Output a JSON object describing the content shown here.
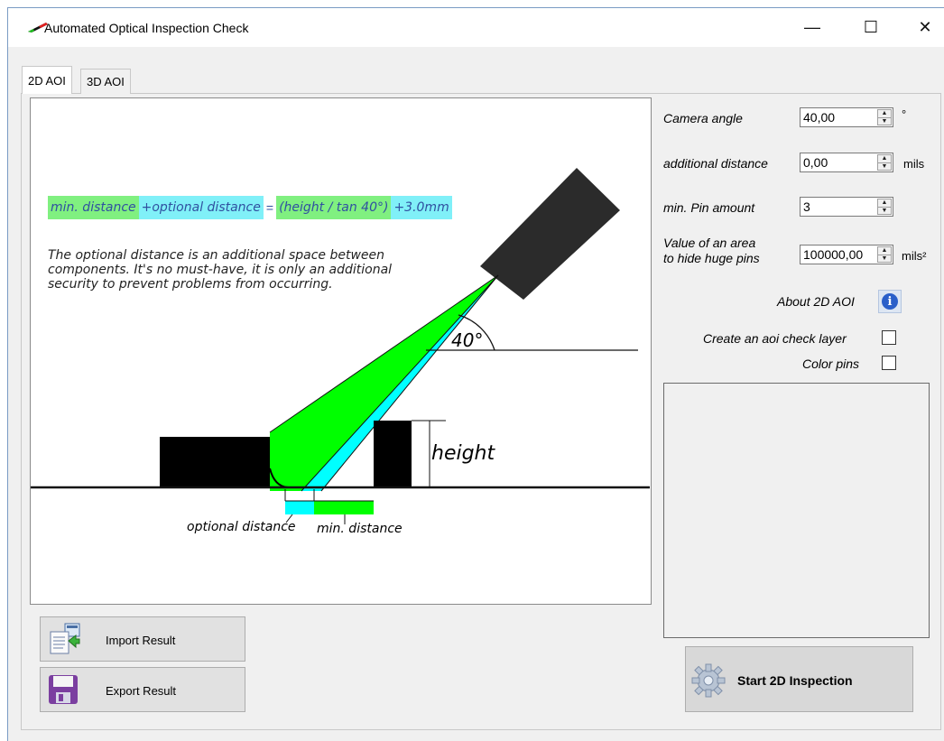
{
  "window": {
    "title": "Automated Optical Inspection Check",
    "controls": {
      "minimize": "—",
      "maximize": "☐",
      "close": "✕"
    }
  },
  "tabs": [
    {
      "label": "2D AOI",
      "active": true
    },
    {
      "label": "3D AOI",
      "active": false
    }
  ],
  "diagram": {
    "formula": {
      "min_distance": "min. distance",
      "optional_distance": "+optional distance",
      "equals": "=",
      "height_tan": "(height / tan 40°)",
      "offset": "+3.0mm"
    },
    "description": "The optional distance is an additional space between components. It's no must-have, it is only an additional security to prevent problems from occurring.",
    "angle_label": "40°",
    "height_label": "height",
    "optional_distance_label": "optional distance",
    "min_distance_label": "min. distance",
    "colors": {
      "green": "#00ff00",
      "cyan": "#00ffff",
      "component": "#000000"
    }
  },
  "settings": {
    "camera_angle": {
      "label": "Camera angle",
      "value": "40,00",
      "unit": "°"
    },
    "additional_distance": {
      "label": "additional distance",
      "value": "0,00",
      "unit": "mils"
    },
    "min_pin_amount": {
      "label": "min. Pin amount",
      "value": "3"
    },
    "huge_pin_area": {
      "label_line1": "Value of an area",
      "label_line2": "to hide huge pins",
      "value": "100000,00",
      "unit": "mils²"
    },
    "about": {
      "label": "About 2D AOI",
      "icon": "info-icon"
    },
    "create_layer": {
      "label": "Create an aoi check layer",
      "checked": false
    },
    "color_pins": {
      "label": "Color pins",
      "checked": false
    }
  },
  "buttons": {
    "import": "Import Result",
    "export": "Export Result",
    "start": "Start 2D Inspection"
  }
}
